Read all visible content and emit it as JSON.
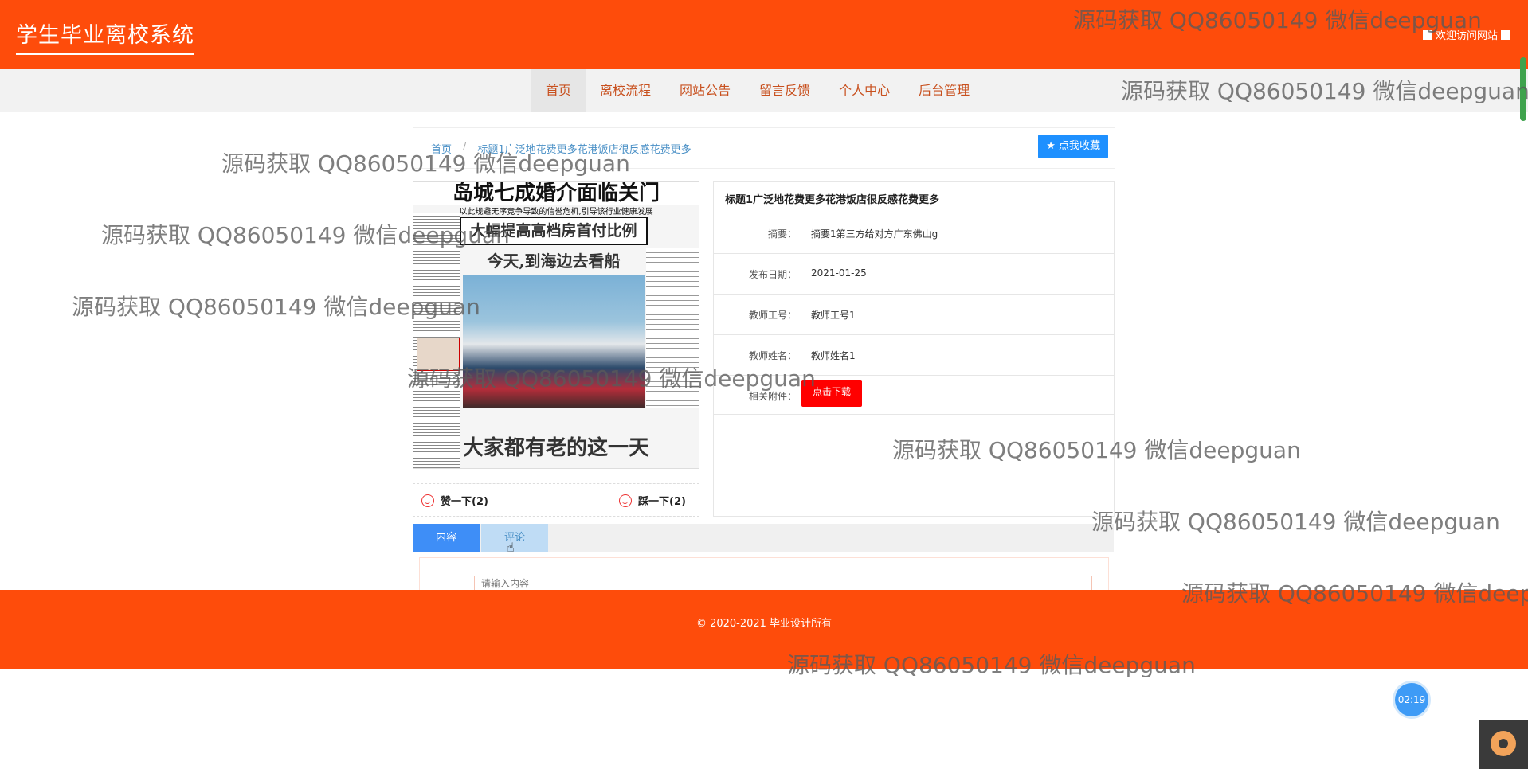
{
  "header": {
    "site_title": "学生毕业离校系统",
    "welcome": "欢迎访问网站"
  },
  "nav": {
    "items": [
      "首页",
      "离校流程",
      "网站公告",
      "留言反馈",
      "个人中心",
      "后台管理"
    ],
    "active": "首页"
  },
  "breadcrumb": {
    "home": "首页",
    "separator": "/",
    "current": "标题1广泛地花费更多花港饭店很反感花费更多"
  },
  "favorite_button": "★ 点我收藏",
  "newspaper": {
    "headline": "岛城七成婚介面临关门",
    "subheadline": "以此规避无序竞争导致的信誉危机,引导该行业健康发展",
    "box_headline": "大幅提高高档房首付比例",
    "story_headline": "今天,到海边去看船",
    "footer_headline": "大家都有老的这一天"
  },
  "votes": {
    "like": "赞一下(2)",
    "dislike": "踩一下(2)"
  },
  "detail": {
    "title": "标题1广泛地花费更多花港饭店很反感花费更多",
    "rows": [
      {
        "label": "摘要：",
        "value": "摘要1第三方给对方广东佛山g"
      },
      {
        "label": "发布日期：",
        "value": "2021-01-25"
      },
      {
        "label": "教师工号：",
        "value": "教师工号1"
      },
      {
        "label": "教师姓名：",
        "value": "教师姓名1"
      }
    ],
    "attachment_label": "相关附件：",
    "download_button": "点击下载"
  },
  "tabs": {
    "content": "内容",
    "comments": "评论"
  },
  "comment": {
    "placeholder": "请输入内容"
  },
  "footer": {
    "copyright": "© 2020-2021 毕业设计所有"
  },
  "timer": "02:19",
  "watermark": "源码获取 QQ86050149 微信deepguan"
}
